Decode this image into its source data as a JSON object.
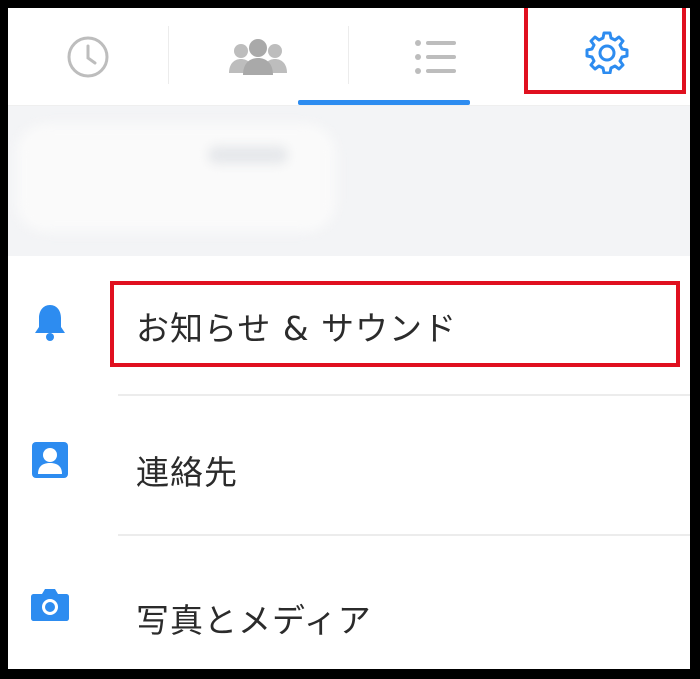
{
  "tabs": [
    {
      "icon": "clock-icon",
      "active": false
    },
    {
      "icon": "people-icon",
      "active": false
    },
    {
      "icon": "list-icon",
      "active": true
    },
    {
      "icon": "gear-icon",
      "active": false,
      "highlighted": true
    }
  ],
  "menu": {
    "items": [
      {
        "icon": "bell-icon",
        "label": "お知らせ & サウンド",
        "highlighted": true
      },
      {
        "icon": "contact-card-icon",
        "label": "連絡先"
      },
      {
        "icon": "camera-icon",
        "label": "写真とメディア"
      }
    ]
  },
  "colors": {
    "accent": "#2d8cf0",
    "highlight": "#e0101f",
    "icon_inactive": "#bdbdbd",
    "text": "#2b2b2b"
  }
}
